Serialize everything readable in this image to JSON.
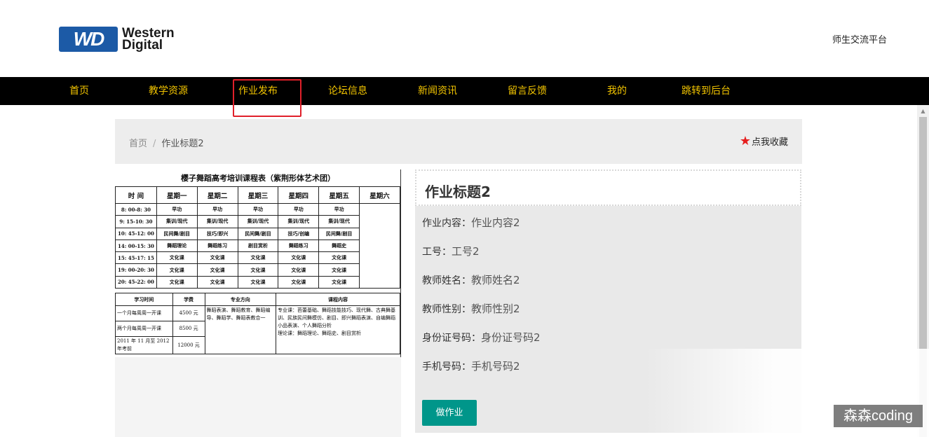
{
  "header": {
    "brand_line1": "Western",
    "brand_line2": "Digital",
    "brand_badge": "WD",
    "platform_name": "师生交流平台"
  },
  "nav": {
    "items": [
      {
        "label": "首页"
      },
      {
        "label": "教学资源"
      },
      {
        "label": "作业发布"
      },
      {
        "label": "论坛信息"
      },
      {
        "label": "新闻资讯"
      },
      {
        "label": "留言反馈"
      },
      {
        "label": "我的"
      },
      {
        "label": "跳转到后台"
      }
    ],
    "active_index": 2
  },
  "breadcrumb": {
    "home": "首页",
    "separator": "/",
    "current": "作业标题2"
  },
  "favorite": {
    "label": "点我收藏",
    "icon": "star-icon",
    "color": "#e61e1e"
  },
  "schedule_image": {
    "title": "樱子舞蹈高考培训课程表（紫荆形体艺术团）",
    "headers": [
      "时 间",
      "星期一",
      "星期二",
      "星期三",
      "星期四",
      "星期五",
      "星期六"
    ],
    "rows": [
      [
        "8: 00-8: 30",
        "早功",
        "早功",
        "早功",
        "早功",
        "早功"
      ],
      [
        "9: 15-10: 30",
        "集训/现代",
        "集训/现代",
        "集训/现代",
        "集训/现代",
        "集训/现代"
      ],
      [
        "10: 45-12: 00",
        "民间舞/剧目",
        "技巧/即兴",
        "民间舞/剧目",
        "技巧/创编",
        "民间舞/剧目"
      ],
      [
        "14: 00-15: 30",
        "舞蹈理论",
        "舞蹈练习",
        "剧目赏析",
        "舞蹈练习",
        "舞蹈史"
      ],
      [
        "15: 45-17: 15",
        "文化课",
        "文化课",
        "文化课",
        "文化课",
        "文化课"
      ],
      [
        "19: 00-20: 30",
        "文化课",
        "文化课",
        "文化课",
        "文化课",
        "文化课"
      ],
      [
        "20: 45-22: 00",
        "文化课",
        "文化课",
        "文化课",
        "文化课",
        "文化课"
      ]
    ],
    "bottom_headers": [
      "学习时间",
      "学费",
      "专业方向",
      "课程内容"
    ],
    "bottom_rows": [
      [
        "一个月每周周一开课",
        "4500 元"
      ],
      [
        "两个月每周周一开课",
        "8500 元"
      ],
      [
        "2011 年 11 月至 2012 年考前",
        "12000 元"
      ]
    ],
    "direction": "舞蹈表演、舞蹈教育、舞蹈编导、舞蹈学、舞蹈表教合一",
    "content_major": "专业课：芭蕾基础、舞蹈技能技巧、现代舞、古典舞基训、民族民间舞模仿、剧目、即兴舞蹈表演、自编舞蹈小品表演、个人舞蹈分析",
    "content_theory": "理论课：舞蹈理论、舞蹈史、剧目赏析"
  },
  "detail": {
    "title": "作业标题2",
    "fields": [
      {
        "label": "作业内容：",
        "value": "作业内容2"
      },
      {
        "label": "工号：",
        "value": "工号2"
      },
      {
        "label": "教师姓名：",
        "value": "教师姓名2"
      },
      {
        "label": "教师性别：",
        "value": "教师性别2"
      },
      {
        "label": "身份证号码：",
        "value": "身份证号码2"
      },
      {
        "label": "手机号码：",
        "value": "手机号码2"
      }
    ],
    "action_button": "做作业"
  },
  "watermark": "森森coding",
  "colors": {
    "nav_bg": "#000000",
    "nav_text": "#f2c400",
    "highlight": "#e0202a",
    "button": "#00968a",
    "brand_blue": "#1c5aa6"
  }
}
